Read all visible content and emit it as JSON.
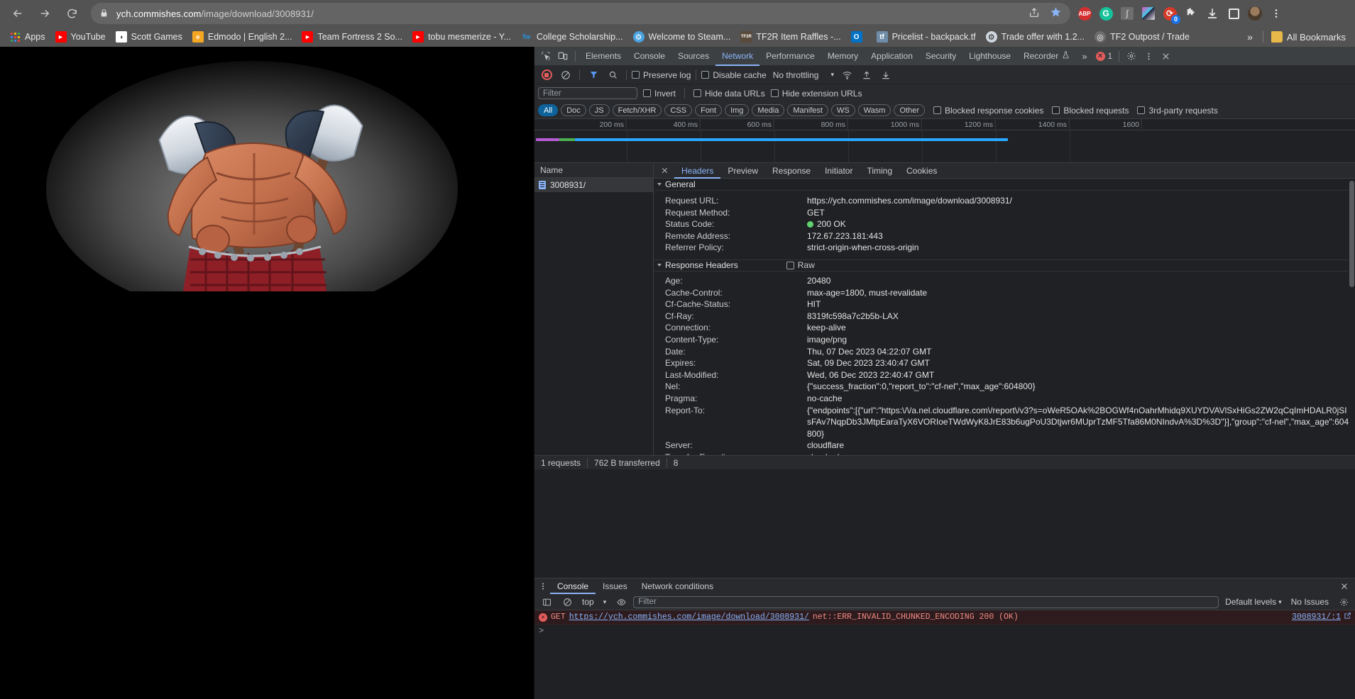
{
  "browser": {
    "url_host": "ych.commishes.com",
    "url_path": "/image/download/3008931/",
    "lock_icon": "lock-icon",
    "back_icon": "back-arrow-icon",
    "forward_icon": "forward-arrow-icon",
    "reload_icon": "reload-icon",
    "share_icon": "share-icon",
    "bookmark_icon": "star-icon",
    "extensions": [
      {
        "name": "adblock-plus-extension-icon",
        "label": "ABP",
        "color": "#d42f2f"
      },
      {
        "name": "grammarly-extension-icon",
        "label": "G",
        "color": "#15c39a"
      },
      {
        "name": "math-extension-icon",
        "label": "ʃ",
        "color": "#6e6e6e"
      },
      {
        "name": "colorful-extension-icon",
        "label": "",
        "color": "#2a2a4a"
      },
      {
        "name": "honey-extension-icon",
        "label": "",
        "color": "#d63a28",
        "badge": "0"
      },
      {
        "name": "puzzle-extensions-icon",
        "label": "",
        "color": "#e8e8e8"
      },
      {
        "name": "downloads-icon",
        "label": "",
        "color": "#e8e8e8"
      },
      {
        "name": "sidepanel-icon",
        "label": "",
        "color": "#e8e8e8"
      }
    ],
    "profile_icon": "profile-avatar",
    "menu_icon": "three-dot-menu-icon"
  },
  "bookmarks": {
    "apps_label": "Apps",
    "items": [
      {
        "label": "YouTube",
        "icon": "youtube-icon",
        "color": "#ff0000",
        "glyph": "▶"
      },
      {
        "label": "Scott Games",
        "icon": "scottgames-icon",
        "color": "#ffffff",
        "glyph": "◑"
      },
      {
        "label": "Edmodo | English 2...",
        "icon": "edmodo-icon",
        "color": "#f5a623",
        "glyph": "e"
      },
      {
        "label": "Team Fortress 2 So...",
        "icon": "youtube-icon",
        "color": "#ff0000",
        "glyph": "▶"
      },
      {
        "label": "tobu mesmerize - Y...",
        "icon": "youtube-icon",
        "color": "#ff0000",
        "glyph": "▶"
      },
      {
        "label": "College Scholarship...",
        "icon": "fastweb-icon",
        "color": "#2c8fd8",
        "glyph": "fw"
      },
      {
        "label": "Welcome to Steam...",
        "icon": "steam-icon",
        "color": "#4aa3e0",
        "glyph": "☸"
      },
      {
        "label": "TF2R Item Raffles -...",
        "icon": "tf2r-icon",
        "color": "#5a4a3a",
        "glyph": "TF2R"
      },
      {
        "label": "",
        "icon": "outlook-icon",
        "color": "#0072c6",
        "glyph": "O"
      },
      {
        "label": "Pricelist - backpack.tf",
        "icon": "backpacktf-icon",
        "color": "#6f8da8",
        "glyph": "tf"
      },
      {
        "label": "Trade offer with 1.2...",
        "icon": "steam-icon",
        "color": "#cfd6dd",
        "glyph": "☸"
      },
      {
        "label": "TF2 Outpost / Trade",
        "icon": "tf2outpost-icon",
        "color": "#6e6e6e",
        "glyph": "◎"
      }
    ],
    "overflow_label": "»",
    "all_bookmarks_label": "All Bookmarks",
    "all_bookmarks_icon": "folder-icon"
  },
  "devtools": {
    "inspect_icon": "inspect-element-icon",
    "device_icon": "device-toolbar-icon",
    "tabs": [
      {
        "label": "Elements",
        "selected": false
      },
      {
        "label": "Console",
        "selected": false
      },
      {
        "label": "Sources",
        "selected": false
      },
      {
        "label": "Network",
        "selected": true
      },
      {
        "label": "Performance",
        "selected": false
      },
      {
        "label": "Memory",
        "selected": false
      },
      {
        "label": "Application",
        "selected": false
      },
      {
        "label": "Security",
        "selected": false
      },
      {
        "label": "Lighthouse",
        "selected": false
      },
      {
        "label": "Recorder",
        "selected": false
      }
    ],
    "recorder_flask_icon": "flask-icon",
    "more_tabs_label": "»",
    "error_count": "1",
    "settings_icon": "gear-icon",
    "more_icon": "three-dot-menu-icon",
    "close_icon": "close-icon"
  },
  "network_toolbar": {
    "record_icon": "record-button",
    "clear_icon": "clear-network-log-icon",
    "filter_icon": "filter-funnel-icon",
    "search_icon": "search-icon",
    "preserve_log_label": "Preserve log",
    "disable_cache_label": "Disable cache",
    "throttling_label": "No throttling",
    "throttling_caret": "▾",
    "wifi_icon": "network-conditions-icon",
    "import_icon": "import-har-icon",
    "export_icon": "export-har-icon",
    "filter_placeholder": "Filter",
    "invert_label": "Invert",
    "hide_data_urls_label": "Hide data URLs",
    "hide_extension_urls_label": "Hide extension URLs",
    "type_chips": [
      "All",
      "Doc",
      "JS",
      "Fetch/XHR",
      "CSS",
      "Font",
      "Img",
      "Media",
      "Manifest",
      "WS",
      "Wasm",
      "Other"
    ],
    "selected_chip": "All",
    "blocked_response_cookies_label": "Blocked response cookies",
    "blocked_requests_label": "Blocked requests",
    "third_party_label": "3rd-party requests"
  },
  "overview": {
    "ticks": [
      "200 ms",
      "400 ms",
      "600 ms",
      "800 ms",
      "1000 ms",
      "1200 ms",
      "1400 ms",
      "1600"
    ]
  },
  "request_list": {
    "header": "Name",
    "rows": [
      {
        "name": "3008931/",
        "icon": "document-file-icon"
      }
    ]
  },
  "detail_tabs": {
    "close_icon": "close-icon",
    "tabs": [
      {
        "label": "Headers",
        "selected": true
      },
      {
        "label": "Preview",
        "selected": false
      },
      {
        "label": "Response",
        "selected": false
      },
      {
        "label": "Initiator",
        "selected": false
      },
      {
        "label": "Timing",
        "selected": false
      },
      {
        "label": "Cookies",
        "selected": false
      }
    ]
  },
  "headers": {
    "general_title": "General",
    "general": [
      {
        "key": "Request URL:",
        "value": "https://ych.commishes.com/image/download/3008931/"
      },
      {
        "key": "Request Method:",
        "value": "GET"
      },
      {
        "key": "Status Code:",
        "value": "200 OK",
        "status": true
      },
      {
        "key": "Remote Address:",
        "value": "172.67.223.181:443"
      },
      {
        "key": "Referrer Policy:",
        "value": "strict-origin-when-cross-origin"
      }
    ],
    "response_title": "Response Headers",
    "raw_label": "Raw",
    "response": [
      {
        "key": "Age:",
        "value": "20480"
      },
      {
        "key": "Cache-Control:",
        "value": "max-age=1800, must-revalidate"
      },
      {
        "key": "Cf-Cache-Status:",
        "value": "HIT"
      },
      {
        "key": "Cf-Ray:",
        "value": "8319fc598a7c2b5b-LAX"
      },
      {
        "key": "Connection:",
        "value": "keep-alive"
      },
      {
        "key": "Content-Type:",
        "value": "image/png"
      },
      {
        "key": "Date:",
        "value": "Thu, 07 Dec 2023 04:22:07 GMT"
      },
      {
        "key": "Expires:",
        "value": "Sat, 09 Dec 2023 23:40:47 GMT"
      },
      {
        "key": "Last-Modified:",
        "value": "Wed, 06 Dec 2023 22:40:47 GMT"
      },
      {
        "key": "Nel:",
        "value": "{\"success_fraction\":0,\"report_to\":\"cf-nel\",\"max_age\":604800}"
      },
      {
        "key": "Pragma:",
        "value": "no-cache"
      },
      {
        "key": "Report-To:",
        "value": "{\"endpoints\":[{\"url\":\"https:\\/\\/a.nel.cloudflare.com\\/report\\/v3?s=oWeR5OAk%2BOGWf4nOahrMhidq9XUYDVAVlSxHiGs2ZW2qCqImHDALR0jSIsFAv7NqpDb3JMtpEaraTyX6VORIoeTWdWyK8JrE83b6ugPoU3Dtjwr6MUprTzMF5Tfa86M0NIndvA%3D%3D\"}],\"group\":\"cf-nel\",\"max_age\":604800}"
      },
      {
        "key": "Server:",
        "value": "cloudflare"
      },
      {
        "key": "Transfer-Encoding:",
        "value": "chunked"
      }
    ]
  },
  "status_bar": {
    "requests": "1 requests",
    "transferred": "762 B transferred",
    "resources": "8"
  },
  "drawer": {
    "kebab_icon": "three-dot-menu-icon",
    "tabs": [
      {
        "label": "Console",
        "selected": true
      },
      {
        "label": "Issues",
        "selected": false
      },
      {
        "label": "Network conditions",
        "selected": false
      }
    ],
    "close_icon": "close-icon",
    "console_toolbar": {
      "sidebar_icon": "console-sidebar-icon",
      "clear_icon": "clear-console-icon",
      "context_label": "top",
      "context_caret": "▾",
      "eye_icon": "live-expression-icon",
      "filter_placeholder": "Filter",
      "levels_label": "Default levels",
      "levels_caret": "▾",
      "issues_label": "No Issues",
      "settings_icon": "gear-icon"
    },
    "error": {
      "method": "GET",
      "url": "https://ych.commishes.com/image/download/3008931/",
      "message": "net::ERR_INVALID_CHUNKED_ENCODING 200 (OK)",
      "source": "3008931/:1",
      "source_icon": "open-in-new-icon"
    },
    "prompt_symbol": ">"
  },
  "colors": {
    "accent": "#8ab4f8",
    "chip_on": "#0e639c",
    "error": "#e45c5c",
    "success": "#62d26f"
  }
}
